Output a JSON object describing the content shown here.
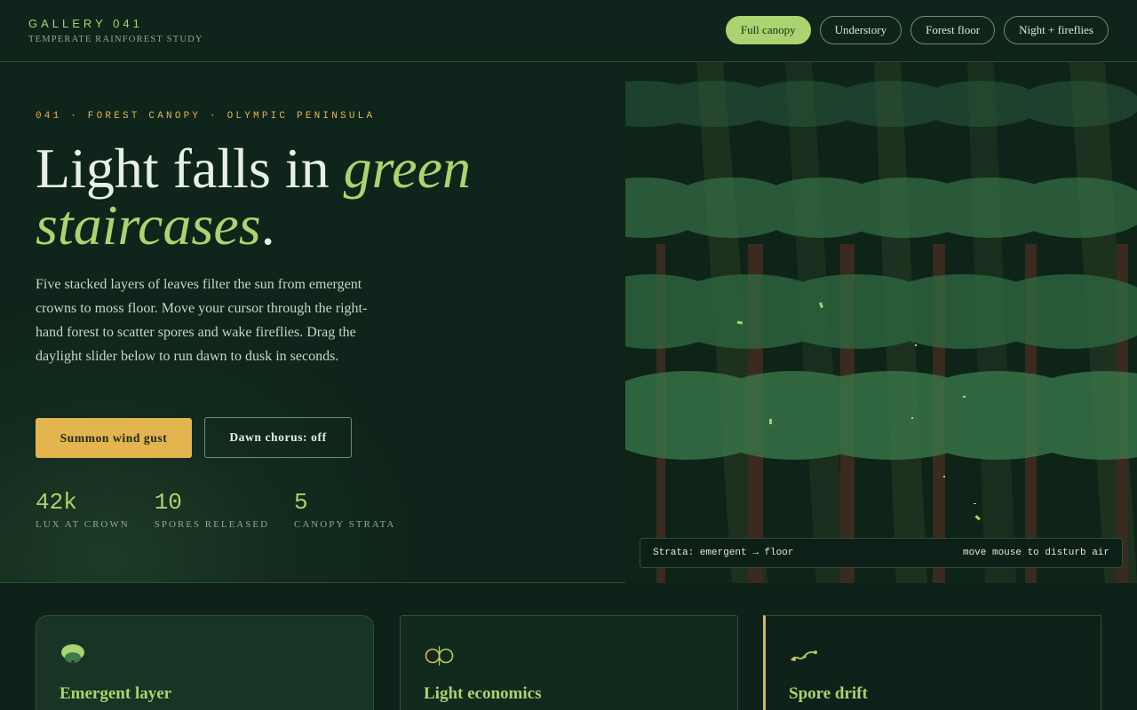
{
  "header": {
    "title": "GALLERY 041",
    "subtitle": "TEMPERATE RAINFOREST STUDY",
    "nav": [
      "Full canopy",
      "Understory",
      "Forest floor",
      "Night + fireflies"
    ],
    "active_nav": "Full canopy"
  },
  "hero": {
    "eyebrow": "041 · FOREST CANOPY · OLYMPIC PENINSULA",
    "headline_plain": "Light falls in ",
    "headline_accent_1": "green",
    "headline_accent_2": "staircases",
    "headline_end": ".",
    "lede": "Five stacked layers of leaves filter the sun from emergent crowns to moss floor. Move your cursor through the right-hand forest to scatter spores and wake fireflies. Drag the daylight slider below to run dawn to dusk in seconds.",
    "primary_button": "Summon wind gust",
    "secondary_button": "Dawn chorus: off",
    "stats": [
      {
        "value": "42k",
        "label": "LUX AT CROWN"
      },
      {
        "value": "10",
        "label": "SPORES RELEASED"
      },
      {
        "value": "5",
        "label": "CANOPY STRATA"
      }
    ]
  },
  "forest": {
    "status_left": "Strata: emergent → floor",
    "status_right": "move mouse to disturb air"
  },
  "cards": [
    {
      "title": "Emergent layer",
      "icon": "tree-icon"
    },
    {
      "title": "Light economics",
      "icon": "lenses-icon"
    },
    {
      "title": "Spore drift",
      "icon": "spore-trail-icon"
    }
  ],
  "colors": {
    "background": "#0e2219",
    "accent_green": "#a9d46f",
    "accent_gold": "#e3b54e",
    "trunk": "#3b2a1f"
  }
}
